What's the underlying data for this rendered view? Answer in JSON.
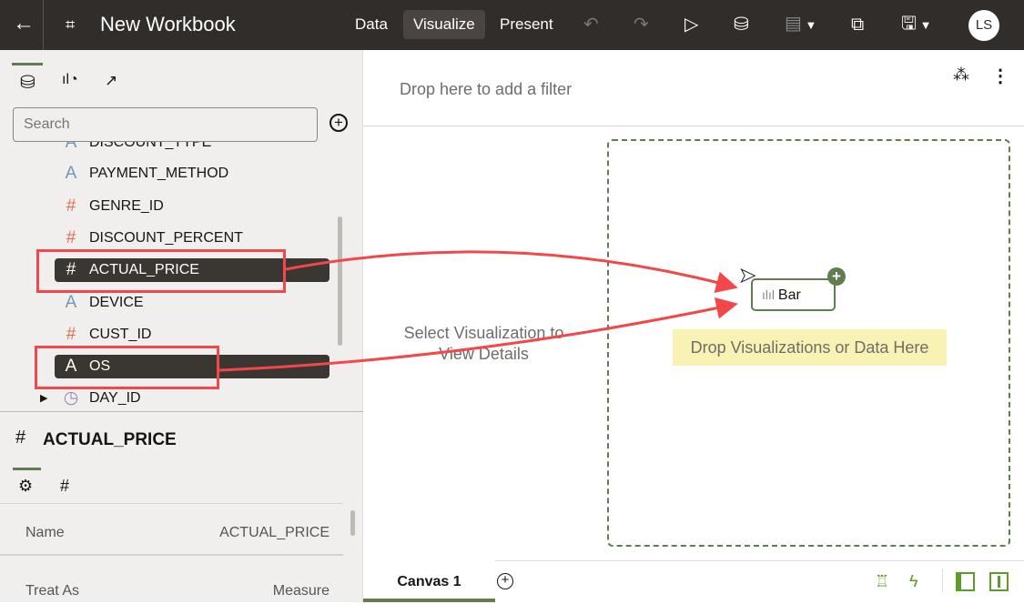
{
  "header": {
    "title": "New Workbook",
    "tabs": [
      {
        "label": "Data"
      },
      {
        "label": "Visualize",
        "active": true
      },
      {
        "label": "Present"
      }
    ],
    "avatar": "LS"
  },
  "left_panel": {
    "search_placeholder": "Search",
    "fields": [
      {
        "name": "DISCOUNT_TYPE",
        "type": "attribute",
        "glyph": "A"
      },
      {
        "name": "PAYMENT_METHOD",
        "type": "attribute",
        "glyph": "A"
      },
      {
        "name": "GENRE_ID",
        "type": "measure",
        "glyph": "#"
      },
      {
        "name": "DISCOUNT_PERCENT",
        "type": "measure",
        "glyph": "#"
      },
      {
        "name": "ACTUAL_PRICE",
        "type": "measure",
        "glyph": "#",
        "selected": true
      },
      {
        "name": "DEVICE",
        "type": "attribute",
        "glyph": "A"
      },
      {
        "name": "CUST_ID",
        "type": "measure",
        "glyph": "#"
      },
      {
        "name": "OS",
        "type": "attribute",
        "glyph": "A",
        "selected": true
      },
      {
        "name": "DAY_ID",
        "type": "time",
        "glyph": "◷"
      }
    ],
    "properties": {
      "glyph": "#",
      "title": "ACTUAL_PRICE",
      "rows": [
        {
          "label": "Name",
          "value": "ACTUAL_PRICE"
        },
        {
          "label": "Treat As",
          "value": "Measure"
        }
      ]
    }
  },
  "main": {
    "filter_placeholder": "Drop here to add a filter",
    "details_hint": "Select Visualization to View Details",
    "drop_hint": "Drop Visualizations or Data Here",
    "viz_chip": "Bar",
    "canvas_tab": "Canvas 1"
  },
  "colors": {
    "header_bg": "#312d2a",
    "accent_green": "#5f7d4f",
    "annotation_red": "#f2474b",
    "drop_highlight": "#f8f3b5"
  }
}
